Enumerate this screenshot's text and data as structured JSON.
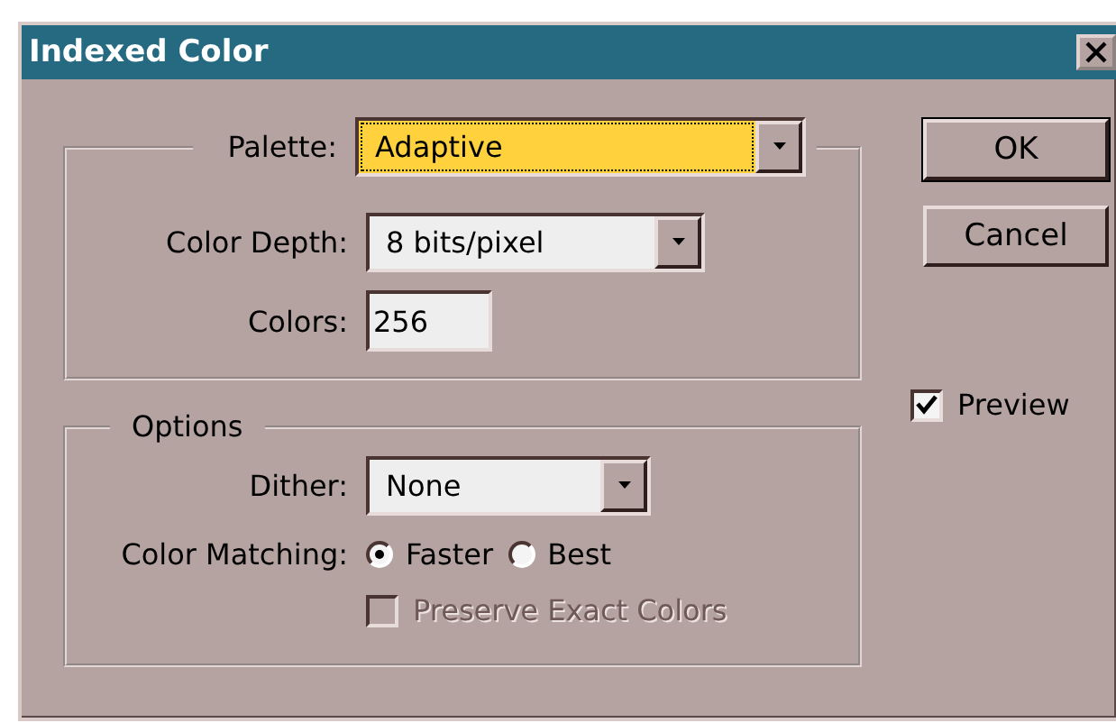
{
  "window": {
    "title": "Indexed Color"
  },
  "palette_group": {
    "fields": [
      {
        "kind": "dropdown",
        "label": "Palette:",
        "value": "Adaptive",
        "focused": true
      },
      {
        "kind": "dropdown",
        "label": "Color Depth:",
        "value": "8 bits/pixel",
        "focused": false
      },
      {
        "kind": "text",
        "label": "Colors:",
        "value": "256"
      }
    ]
  },
  "options_group": {
    "title": "Options",
    "fields": [
      {
        "kind": "dropdown",
        "label": "Dither:",
        "value": "None",
        "focused": false
      }
    ],
    "color_matching": {
      "label": "Color Matching:",
      "options": [
        {
          "label": "Faster",
          "selected": true
        },
        {
          "label": "Best",
          "selected": false
        }
      ]
    },
    "preserve_exact_colors": {
      "label": "Preserve Exact Colors",
      "checked": false,
      "disabled": true
    }
  },
  "buttons": [
    {
      "label": "OK",
      "default": true
    },
    {
      "label": "Cancel",
      "default": false
    }
  ],
  "preview": {
    "label": "Preview",
    "checked": true
  }
}
